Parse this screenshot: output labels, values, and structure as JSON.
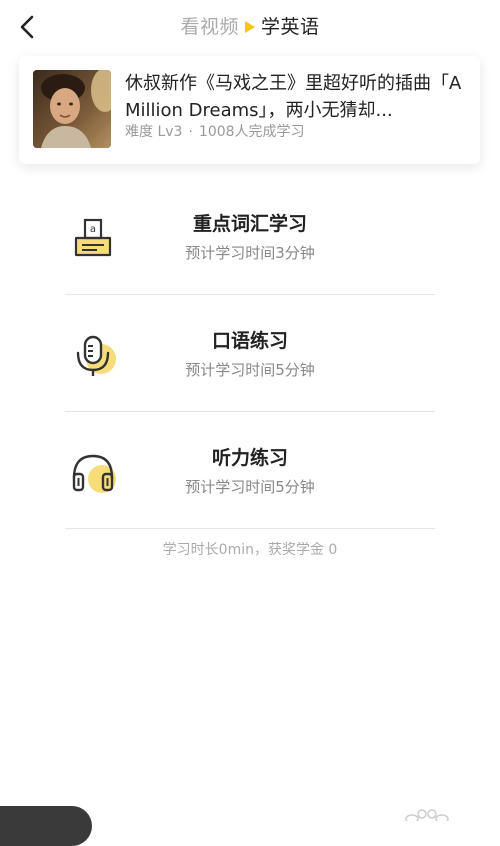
{
  "header": {
    "tab_video": "看视频",
    "tab_english": "学英语",
    "back_icon": "chevron-left-icon",
    "accent_color": "#f5c518"
  },
  "video": {
    "title": "休叔新作《马戏之王》里超好听的插曲「A Million Dreams」，两小无猜却...",
    "difficulty": "难度 Lv3",
    "completed": "1008人完成学习"
  },
  "study_items": [
    {
      "title": "重点词汇学习",
      "subtitle": "预计学习时间3分钟",
      "icon": "vocabulary-card-icon"
    },
    {
      "title": "口语练习",
      "subtitle": "预计学习时间5分钟",
      "icon": "microphone-icon"
    },
    {
      "title": "听力练习",
      "subtitle": "预计学习时间5分钟",
      "icon": "headphones-icon"
    }
  ],
  "summary": "学习时长0min，获奖学金 0"
}
